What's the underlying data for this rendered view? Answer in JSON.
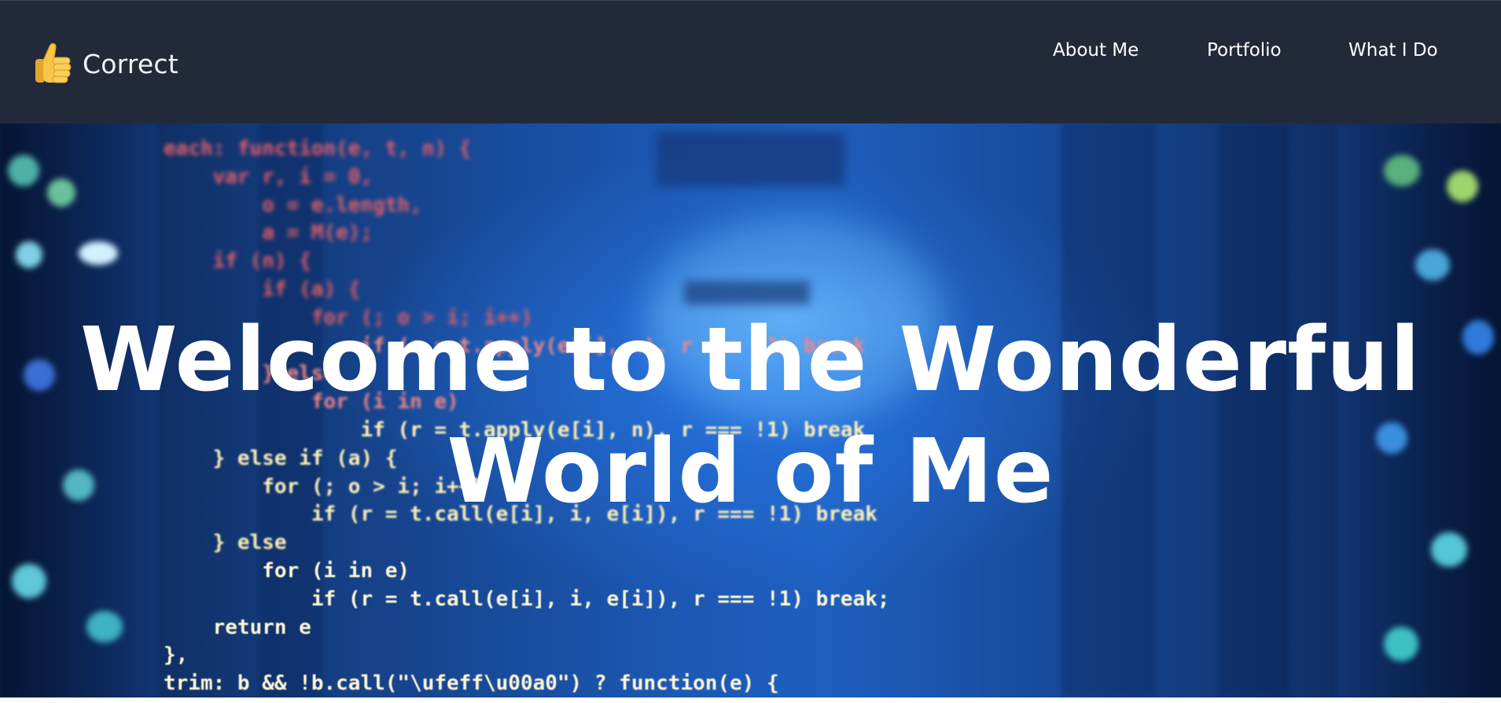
{
  "navbar": {
    "brand": {
      "icon": "thumbs-up-icon",
      "name": "Correct"
    },
    "links": [
      {
        "label": "About Me"
      },
      {
        "label": "Portfolio"
      },
      {
        "label": "What I Do"
      }
    ]
  },
  "hero": {
    "title_line_1": "Welcome to the Wonderful",
    "title_line_2": "World of Me",
    "background_code": [
      "each: function(e, t, n) {",
      "    var r, i = 0,",
      "        o = e.length,",
      "        a = M(e);",
      "    if (n) {",
      "        if (a) {",
      "            for (; o > i; i++)",
      "                if (r = t.apply(e[i], n), r === !1) break",
      "        } else",
      "            for (i in e)",
      "                if (r = t.apply(e[i], n), r === !1) break",
      "    } else if (a) {",
      "        for (; o > i; i++)",
      "            if (r = t.call(e[i], i, e[i]), r === !1) break",
      "    } else",
      "        for (i in e)",
      "            if (r = t.call(e[i], i, e[i]), r === !1) break;",
      "    return e",
      "},",
      "trim: b && !b.call(\"\\ufeff\\u00a0\") ? function(e) {"
    ]
  },
  "colors": {
    "navbar_bg": "#222a39",
    "nav_text": "#ffffff",
    "hero_blue": "#1e5fbf",
    "title_text": "#ffffff",
    "thumb_yellow": "#f6c549"
  }
}
